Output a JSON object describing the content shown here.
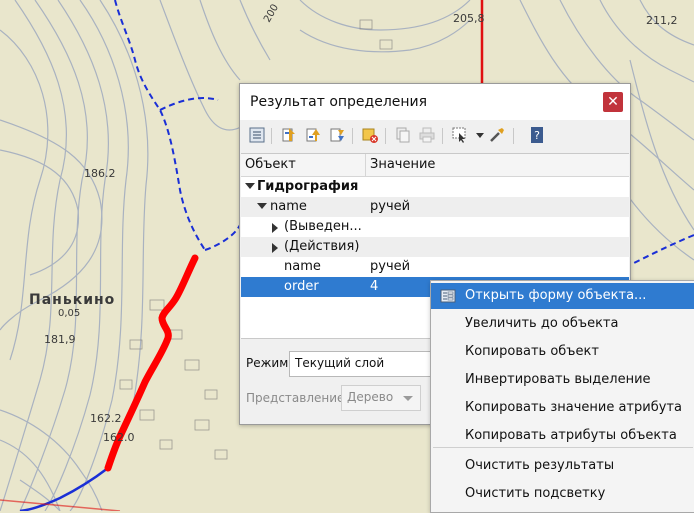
{
  "map": {
    "labels": {
      "elev_205": "205,8",
      "elev_211": "211,2",
      "elev_200": "200",
      "elev_186": "186.2",
      "village": "Панькино",
      "village_sub": "0,05",
      "elev_181": "181,9",
      "elev_162a": "162.2",
      "elev_162b": "162.0"
    },
    "colors": {
      "paper": "#e9e6cc",
      "contour": "#9ea9bf",
      "stream": "#1a2fd6",
      "selected_feature": "#ff0000",
      "boundary": "#e01010"
    }
  },
  "panel": {
    "title": "Результат определения",
    "close_icon": "close-icon",
    "toolbar_icons": [
      "expand-tree-icon",
      "collapse-tree-icon",
      "expand-new-icon",
      "expand-all-icon",
      "clear-results-icon",
      "copy-feature-icon",
      "print-icon",
      "select-features-icon",
      "identify-settings-icon",
      "help-icon"
    ],
    "columns": {
      "feature": "Объект",
      "value": "Значение"
    },
    "rows": [
      {
        "label": "Гидрография",
        "value": ""
      },
      {
        "label": "name",
        "value": "ручей"
      },
      {
        "label": "(Выведен...",
        "value": ""
      },
      {
        "label": "(Действия)",
        "value": ""
      },
      {
        "label": "name",
        "value": "ручей"
      },
      {
        "label": "order",
        "value": "4"
      }
    ],
    "mode_label": "Режим",
    "mode_value": "Текущий слой",
    "view_label": "Представление",
    "view_value": "Дерево"
  },
  "context_menu": {
    "items": [
      {
        "label": "Открыть форму объекта...",
        "icon": "form-icon"
      },
      {
        "label": "Увеличить до объекта"
      },
      {
        "label": "Копировать объект"
      },
      {
        "label": "Инвертировать выделение"
      },
      {
        "label": "Копировать значение атрибута"
      },
      {
        "label": "Копировать атрибуты объекта"
      },
      {
        "label": "Очистить результаты"
      },
      {
        "label": "Очистить подсветку"
      }
    ]
  }
}
